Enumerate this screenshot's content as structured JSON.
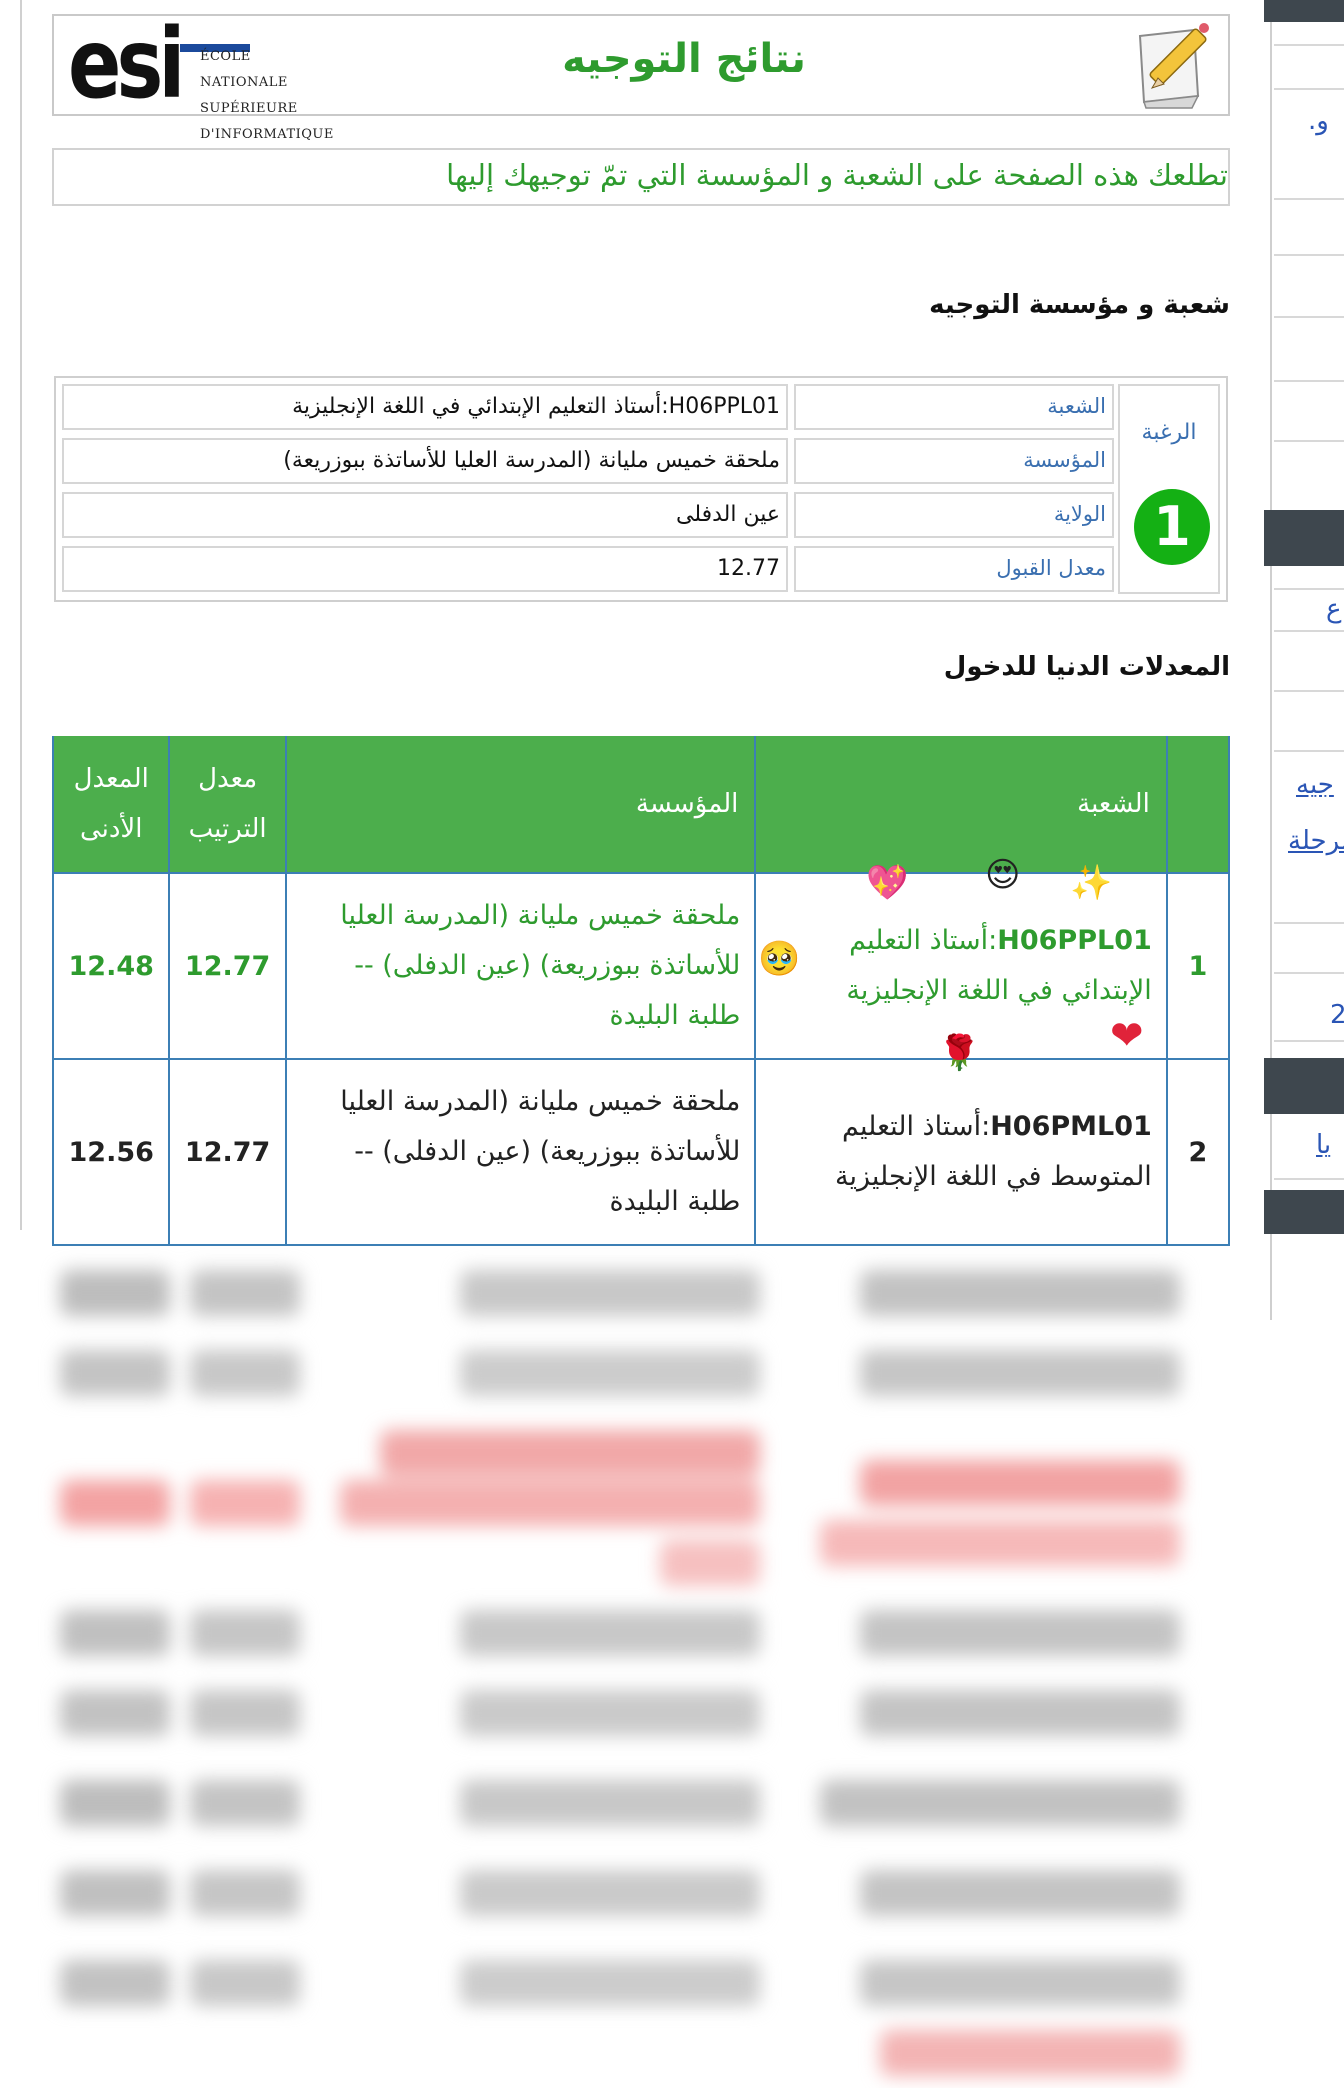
{
  "header": {
    "logo_text": "esi",
    "school_line1": "ÉCOLE NATIONALE",
    "school_line2": "SUPÉRIEURE",
    "school_line3": "D'INFORMATIQUE",
    "title": "نتائج التوجيه"
  },
  "info_text": "تطلعك هذه الصفحة على الشعبة و المؤسسة التي تمّ توجيهك إليها",
  "orientation_section": {
    "title": "شعبة و مؤسسة التوجيه",
    "choice_label": "الرغبة",
    "choice_number": "1",
    "rows": [
      {
        "label": "الشعبة",
        "value": "H06PPL01:أستاذ التعليم الإبتدائي في اللغة الإنجليزية"
      },
      {
        "label": "المؤسسة",
        "value": "ملحقة خميس مليانة (المدرسة العليا للأساتذة ببوزريعة)"
      },
      {
        "label": "الولاية",
        "value": "عين الدفلى"
      },
      {
        "label": "معدل القبول",
        "value": "12.77"
      }
    ]
  },
  "min_section": {
    "title": "المعدلات الدنيا للدخول",
    "headers": {
      "rank": "",
      "field": "الشعبة",
      "institution": "المؤسسة",
      "rank_avg_line1": "معدل",
      "rank_avg_line2": "الترتيب",
      "min_avg_line1": "المعدل",
      "min_avg_line2": "الأدنى"
    },
    "rows": [
      {
        "rank": "1",
        "code": "H06PPL01",
        "field_line1": ":أستاذ التعليم",
        "field_line2": "الإبتدائي في اللغة الإنجليزية",
        "inst_line1": "ملحقة خميس مليانة (المدرسة العليا",
        "inst_line2": "للأساتذة ببوزريعة) (عين الدفلى) --",
        "inst_line3": "طلبة البليدة",
        "rank_avg": "12.77",
        "min_avg": "12.48"
      },
      {
        "rank": "2",
        "code": "H06PML01",
        "field_line1": ":أستاذ التعليم",
        "field_line2": "المتوسط في اللغة الإنجليزية",
        "inst_line1": "ملحقة خميس مليانة (المدرسة العليا",
        "inst_line2": "للأساتذة ببوزريعة) (عين الدفلى) --",
        "inst_line3": "طلبة البليدة",
        "rank_avg": "12.77",
        "min_avg": "12.56"
      }
    ]
  },
  "emojis": {
    "sparkles": "✨",
    "heart_eyes": "😍",
    "heart_glow": "💖",
    "teary_face": "🥹",
    "rose": "🌹",
    "red_heart": "❤"
  },
  "sidebar": {
    "fragment1": "و.",
    "fragment2": "ع",
    "link1": "جيه",
    "link2": "مرحلة",
    "fragment3": "2",
    "link3": "يا"
  },
  "colors": {
    "accent_green": "#2e9b2e",
    "header_green": "#4cae4c",
    "badge_green": "#14b014",
    "link_blue": "#3a6fb0",
    "sidebar_dark": "#3e474e"
  }
}
